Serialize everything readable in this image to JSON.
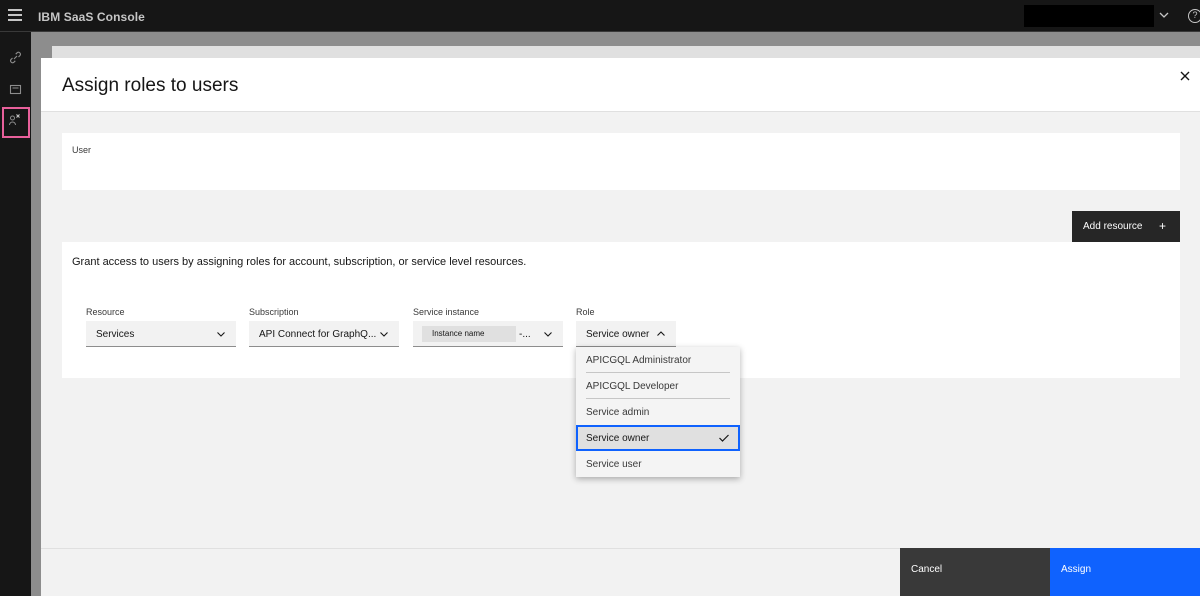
{
  "header": {
    "app_name": "IBM SaaS Console"
  },
  "modal": {
    "title": "Assign roles to users",
    "user_label": "User",
    "add_resource_label": "Add resource",
    "add_resource_icon": "plus-icon",
    "grant_text": "Grant access to users by assigning roles for account, subscription, or service level resources.",
    "fields": {
      "resource": {
        "label": "Resource",
        "value": "Services"
      },
      "subscription": {
        "label": "Subscription",
        "value": "API Connect for GraphQ..."
      },
      "service_instance": {
        "label": "Service instance",
        "tag": "Instance name",
        "suffix": "-..."
      },
      "role": {
        "label": "Role",
        "value": "Service owner"
      }
    },
    "role_options": [
      {
        "label": "APICGQL Administrator",
        "selected": false
      },
      {
        "label": "APICGQL Developer",
        "selected": false
      },
      {
        "label": "Service admin",
        "selected": false
      },
      {
        "label": "Service owner",
        "selected": true
      },
      {
        "label": "Service user",
        "selected": false
      }
    ],
    "cancel_label": "Cancel",
    "assign_label": "Assign"
  },
  "colors": {
    "primary": "#0f62fe",
    "header_bg": "#161616",
    "highlight": "#e8609b"
  }
}
